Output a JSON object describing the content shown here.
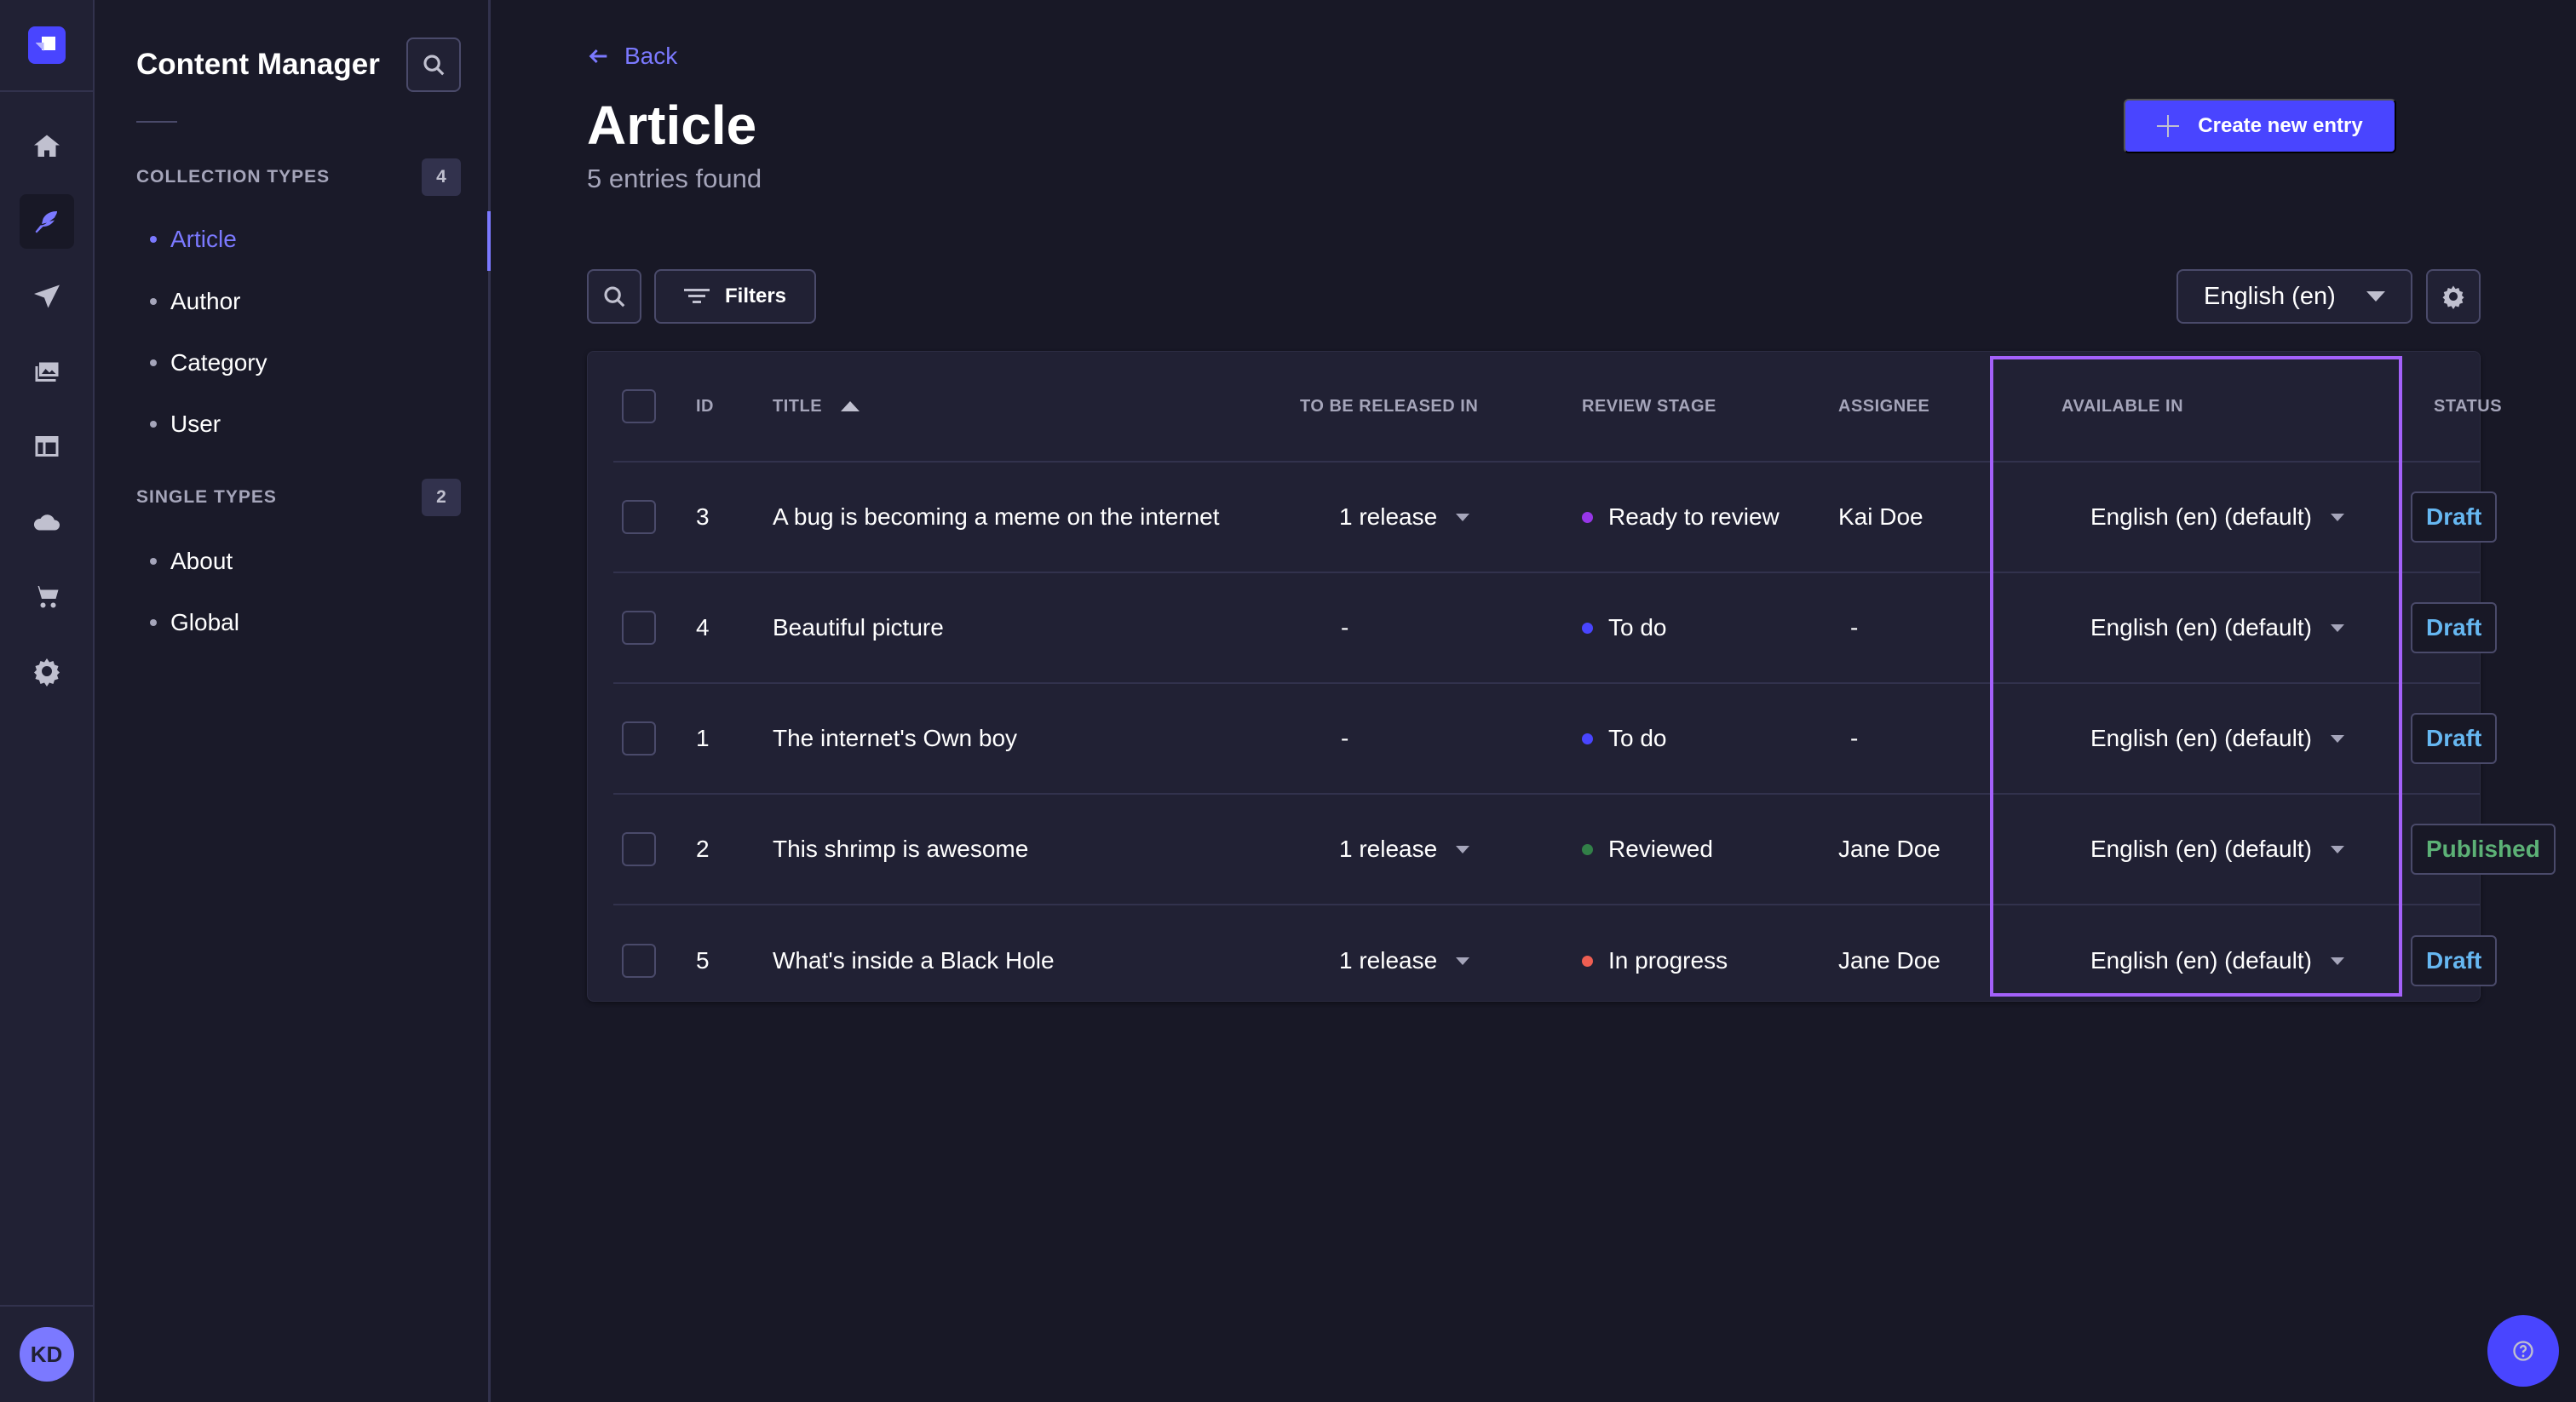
{
  "main_nav": {
    "logo": "strapi-logo-icon",
    "items": [
      {
        "icon": "home-icon",
        "label": "Home",
        "active": false
      },
      {
        "icon": "feather-icon",
        "label": "Content Manager",
        "active": true
      },
      {
        "icon": "paper-plane-icon",
        "label": "Releases",
        "active": false
      },
      {
        "icon": "images-icon",
        "label": "Media Library",
        "active": false
      },
      {
        "icon": "layout-icon",
        "label": "Content-Type Builder",
        "active": false
      },
      {
        "icon": "cloud-icon",
        "label": "Deploy",
        "active": false
      },
      {
        "icon": "cart-icon",
        "label": "Marketplace",
        "active": false
      },
      {
        "icon": "gear-icon",
        "label": "Settings",
        "active": false
      }
    ],
    "user_initials": "KD"
  },
  "sub_nav": {
    "title": "Content Manager",
    "sections": [
      {
        "label": "COLLECTION TYPES",
        "count": "4",
        "items": [
          {
            "label": "Article",
            "active": true
          },
          {
            "label": "Author",
            "active": false
          },
          {
            "label": "Category",
            "active": false
          },
          {
            "label": "User",
            "active": false
          }
        ]
      },
      {
        "label": "SINGLE TYPES",
        "count": "2",
        "items": [
          {
            "label": "About",
            "active": false
          },
          {
            "label": "Global",
            "active": false
          }
        ]
      }
    ]
  },
  "header": {
    "back_label": "Back",
    "title": "Article",
    "subtitle": "5 entries found",
    "create_label": "Create new entry"
  },
  "toolbar": {
    "filters_label": "Filters",
    "locale": "English (en)"
  },
  "table": {
    "columns": {
      "id": "ID",
      "title": "TITLE",
      "release": "TO BE RELEASED IN",
      "review_stage": "REVIEW STAGE",
      "assignee": "ASSIGNEE",
      "available_in": "AVAILABLE IN",
      "status": "STATUS"
    },
    "sort": {
      "column": "title",
      "direction": "ascending"
    },
    "rows": [
      {
        "id": "3",
        "title": "A bug is becoming a meme on the internet",
        "release": "1 release",
        "has_release_menu": true,
        "stage": "Ready to review",
        "stage_color": "#9736e8",
        "assignee": "Kai Doe",
        "available_in": "English (en) (default)",
        "status": "Draft",
        "status_color": "#66b7f1"
      },
      {
        "id": "4",
        "title": "Beautiful picture",
        "release": "-",
        "has_release_menu": false,
        "stage": "To do",
        "stage_color": "#4945ff",
        "assignee": "-",
        "available_in": "English (en) (default)",
        "status": "Draft",
        "status_color": "#66b7f1"
      },
      {
        "id": "1",
        "title": "The internet's Own boy",
        "release": "-",
        "has_release_menu": false,
        "stage": "To do",
        "stage_color": "#4945ff",
        "assignee": "-",
        "available_in": "English (en) (default)",
        "status": "Draft",
        "status_color": "#66b7f1"
      },
      {
        "id": "2",
        "title": "This shrimp is awesome",
        "release": "1 release",
        "has_release_menu": true,
        "stage": "Reviewed",
        "stage_color": "#328048",
        "assignee": "Jane Doe",
        "available_in": "English (en) (default)",
        "status": "Published",
        "status_color": "#5cb176"
      },
      {
        "id": "5",
        "title": "What's inside a Black Hole",
        "release": "1 release",
        "has_release_menu": true,
        "stage": "In progress",
        "stage_color": "#ee5e52",
        "assignee": "Jane Doe",
        "available_in": "English (en) (default)",
        "status": "Draft",
        "status_color": "#66b7f1"
      }
    ]
  },
  "colors": {
    "accent": "#4945ff",
    "accent_light": "#7b79ff",
    "highlight_box": "#a461fa",
    "background": "#181826",
    "surface": "#212134"
  }
}
